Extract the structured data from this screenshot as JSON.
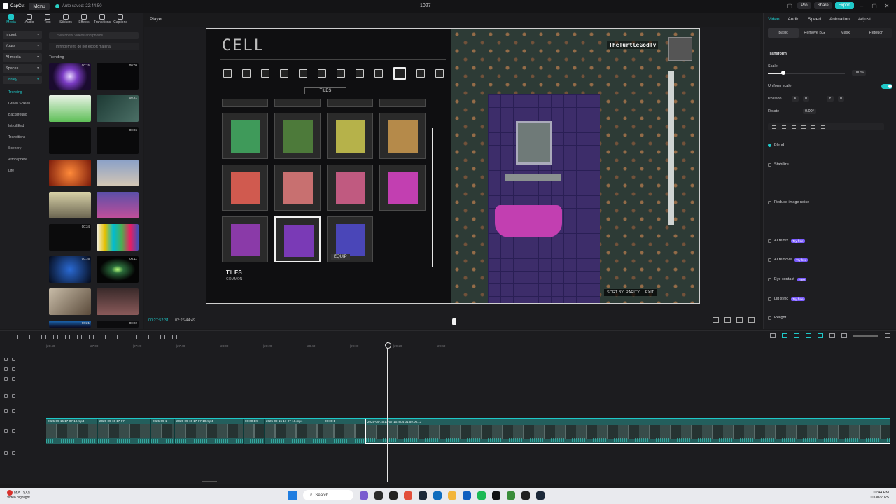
{
  "app": {
    "logo_text": "CapCut",
    "menu_label": "Menu",
    "autosave_text": "Auto saved: 22:44:50",
    "project_title": "1027",
    "pro_label": "Pro",
    "share_label": "Share",
    "export_label": "Export"
  },
  "media_tabs": [
    {
      "label": "Media",
      "icon": "media-icon"
    },
    {
      "label": "Audio",
      "icon": "audio-icon"
    },
    {
      "label": "Text",
      "icon": "text-icon"
    },
    {
      "label": "Stickers",
      "icon": "stickers-icon"
    },
    {
      "label": "Effects",
      "icon": "effects-icon"
    },
    {
      "label": "Transitions",
      "icon": "transitions-icon"
    },
    {
      "label": "Captions",
      "icon": "captions-icon"
    }
  ],
  "side_nav": {
    "import": "Import",
    "yours": "Yours",
    "ai_media": "AI media",
    "spaces": "Spaces",
    "library": "Library",
    "sub": [
      "Trending",
      "Green Screen",
      "Background",
      "Intro&End",
      "Transitions",
      "Scenery",
      "Atmosphere",
      "Life"
    ]
  },
  "library": {
    "search_placeholder": "Search for videos and photos",
    "warning": "Infringement, do not export material",
    "section": "Trending",
    "durations": [
      "00:15",
      "00:09",
      "",
      "00:21",
      "",
      "00:06",
      "",
      "",
      "",
      "",
      "00:34",
      "",
      "00:16",
      "00:11",
      "",
      "",
      "00:21",
      "00:22"
    ]
  },
  "player": {
    "label": "Player",
    "timecode_current": "00:27:52:31",
    "timecode_total": "02:26:44:49"
  },
  "game": {
    "title": "CELL",
    "tab_label": "TILES",
    "item_name": "TILES",
    "item_rarity": "COMMON",
    "equip_label": "EQUIP",
    "streamer_name": "TheTurtleGodTv",
    "sort_label": "SORT BY: RARITY",
    "exit_label": "EXIT"
  },
  "inspector": {
    "tabs": [
      "Video",
      "Audio",
      "Speed",
      "Animation",
      "Adjust"
    ],
    "subtabs": [
      "Basic",
      "Remove BG",
      "Mask",
      "Retouch"
    ],
    "transform": "Transform",
    "scale_label": "Scale",
    "scale_value": "100%",
    "scale_fraction": 0.2,
    "uniform_scale": "Uniform scale",
    "position_label": "Position",
    "pos_x_label": "X",
    "pos_x": "0",
    "pos_y_label": "Y",
    "pos_y": "0",
    "rotate_label": "Rotate",
    "rotate_value": "0.00°",
    "features": [
      {
        "label": "Blend",
        "tag": "",
        "on": true
      },
      {
        "label": "Stabilize",
        "tag": "",
        "on": false
      },
      {
        "label": "Reduce image noise",
        "tag": "",
        "on": false
      },
      {
        "label": "AI remix",
        "tag": "Try free",
        "on": false
      },
      {
        "label": "AI remove",
        "tag": "Try free",
        "on": false
      },
      {
        "label": "Eye contact",
        "tag": "Free",
        "on": false
      },
      {
        "label": "Lip sync",
        "tag": "Try free",
        "on": false
      },
      {
        "label": "Relight",
        "tag": "",
        "on": false
      }
    ]
  },
  "timeline": {
    "ruler": [
      "|26:40",
      "|27:00",
      "|27:20",
      "|27:40",
      "|28:00",
      "|28:20",
      "|28:40",
      "|29:00",
      "|29:20",
      "|29:40"
    ],
    "clips": [
      "2025-09-15 17-07-10.mp4",
      "2025-09-15 17-07",
      "2025-09-1",
      "2025-09-15 17-07-10.mp4",
      "00:00:1:5",
      "2025-09-15 17-07-10.mp4",
      "00:00:1",
      "2025-09-15 17-07-10.mp4 01:59:06:13"
    ]
  },
  "taskbar": {
    "weather_temp": "MIA - SAS",
    "weather_desc": "Video highlight",
    "search": "Search",
    "time": "10:44 PM",
    "date": "10/30/2025"
  },
  "colors": {
    "accent": "#1fc8c8",
    "blend_on": "#1fc8c8"
  }
}
